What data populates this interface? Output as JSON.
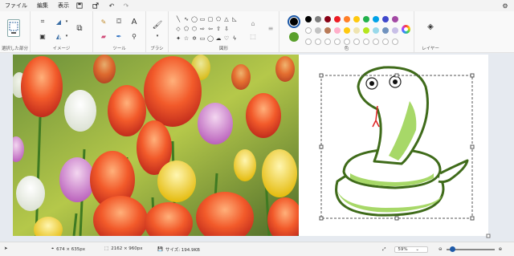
{
  "menu": {
    "file": "ファイル",
    "edit": "編集",
    "view": "表示"
  },
  "groups": {
    "selection": "選択した部分",
    "image": "イメージ",
    "tools": "ツール",
    "brush": "ブラシ",
    "shapes": "図形",
    "colors": "色",
    "layers": "レイヤー"
  },
  "colors": {
    "color1": "#000000",
    "color2": "#5aa02c",
    "palette_row1": [
      "#000000",
      "#7f7f7f",
      "#880015",
      "#ed1c24",
      "#ff7f27",
      "#ffc90e",
      "#22b14c",
      "#00a2e8",
      "#3f48cc",
      "#a349a4"
    ],
    "palette_row2": [
      "#ffffff",
      "#c3c3c3",
      "#b97a57",
      "#ffaec9",
      "#ffc90e",
      "#efe4b0",
      "#b5e61d",
      "#99d9ea",
      "#7092be",
      "#c8bfe7"
    ]
  },
  "status": {
    "cursor_pos": "674 × 635px",
    "selection_size": "2162 × 960px",
    "file_size": "サイズ: 194.9KB",
    "zoom": "59%"
  }
}
